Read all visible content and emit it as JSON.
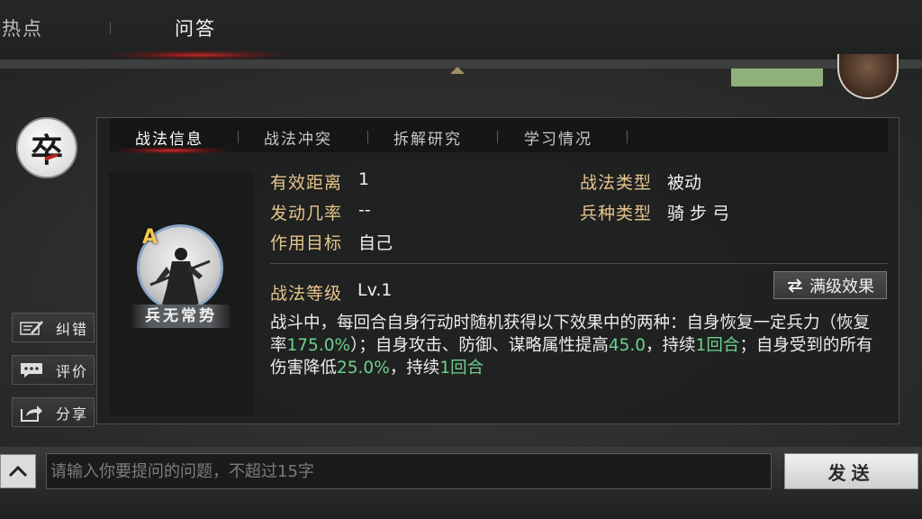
{
  "top_tabs": {
    "hot": "热点",
    "qa": "问答"
  },
  "rank_badge": "卒",
  "card_tabs": [
    "战法信息",
    "战法冲突",
    "拆解研究",
    "学习情况"
  ],
  "skill": {
    "grade": "A",
    "name": "兵无常势",
    "fields": {
      "range_label": "有效距离",
      "range_value": "1",
      "rate_label": "发动几率",
      "rate_value": "--",
      "target_label": "作用目标",
      "target_value": "自己",
      "type_label": "战法类型",
      "type_value": "被动",
      "troop_label": "兵种类型",
      "troop_value": "骑 步 弓"
    },
    "level_label": "战法等级",
    "level_value": "Lv.1",
    "max_effect_label": "满级效果",
    "description": {
      "p1": "战斗中，每回合自身行动时随机获得以下效果中的两种：自身恢复一定兵力（恢复率",
      "v1": "175.0%",
      "p2": "）；自身攻击、防御、谋略属性提高",
      "v2": "45.0",
      "p3": "，持续",
      "v3": "1回合",
      "p4": "；自身受到的所有伤害降低",
      "v4": "25.0%",
      "p5": "，持续",
      "v5": "1回合"
    }
  },
  "side_buttons": {
    "correct": "纠错",
    "comment": "评价",
    "share": "分享"
  },
  "input": {
    "placeholder": "请输入你要提问的问题，不超过15字"
  },
  "send_label": "发送",
  "colors": {
    "highlight": "#6ed08c",
    "label": "#e4c48a",
    "grade": "#f1c84a"
  }
}
